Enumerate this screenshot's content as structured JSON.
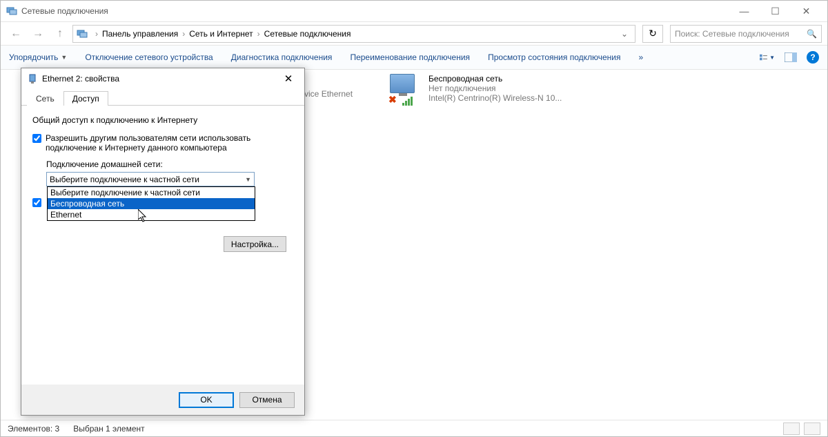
{
  "window": {
    "title": "Сетевые подключения"
  },
  "breadcrumb": {
    "item1": "Панель управления",
    "item2": "Сеть и Интернет",
    "item3": "Сетевые подключения"
  },
  "search": {
    "placeholder": "Поиск: Сетевые подключения"
  },
  "toolbar": {
    "organize": "Упорядочить",
    "disable": "Отключение сетевого устройства",
    "diagnose": "Диагностика подключения",
    "rename": "Переименование подключения",
    "status": "Просмотр состояния подключения"
  },
  "connections": {
    "eth_partial": "le Device Ethernet",
    "wifi": {
      "name": "Беспроводная сеть",
      "status": "Нет подключения",
      "device": "Intel(R) Centrino(R) Wireless-N 10..."
    }
  },
  "statusbar": {
    "elements": "Элементов: 3",
    "selected": "Выбран 1 элемент"
  },
  "dialog": {
    "title": "Ethernet 2: свойства",
    "tab_network": "Сеть",
    "tab_sharing": "Доступ",
    "group_title": "Общий доступ к подключению к Интернету",
    "allow_label": "Разрешить другим пользователям сети использовать подключение к Интернету данного компьютера",
    "home_label": "Подключение домашней сети:",
    "combo_value": "Выберите подключение к частной сети",
    "dd_option1": "Выберите подключение к частной сети",
    "dd_option2": "Беспроводная сеть",
    "dd_option3": "Ethernet",
    "settings_btn": "Настройка...",
    "ok": "OK",
    "cancel": "Отмена"
  }
}
